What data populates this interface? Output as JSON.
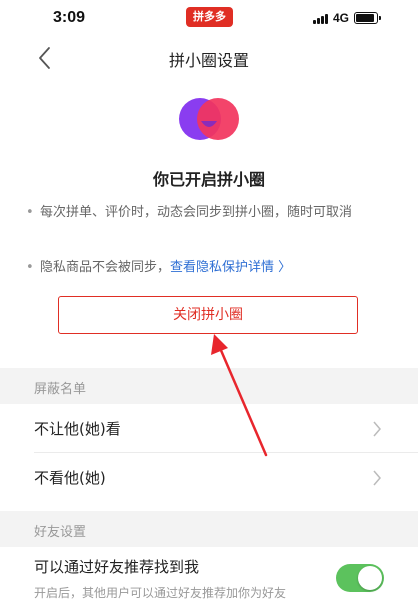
{
  "status_bar": {
    "time": "3:09",
    "app_badge": "拼多多",
    "network": "4G",
    "battery_level": 0.8
  },
  "nav": {
    "title": "拼小圈设置",
    "back_icon": "chevron-left-icon"
  },
  "hero": {
    "icon": "pin-circle-logo-icon",
    "title": "你已开启拼小圈",
    "colors": {
      "purple": "#8a3df0",
      "pink": "#f2345d"
    }
  },
  "bullets": [
    {
      "text": "每次拼单、评价时，动态会同步到拼小圈，随时可取消"
    },
    {
      "text": "隐私商品不会被同步，",
      "link": "查看隐私保护详情 〉"
    }
  ],
  "close_button": {
    "label": "关闭拼小圈"
  },
  "blocklist": {
    "header": "屏蔽名单",
    "items": [
      {
        "label": "不让他(她)看"
      },
      {
        "label": "不看他(她)"
      }
    ]
  },
  "friends": {
    "header": "好友设置",
    "toggle_title": "可以通过好友推荐找到我",
    "toggle_desc": "开启后，其他用户可以通过好友推荐加你为好友",
    "toggle_on": true
  },
  "colors": {
    "accent": "#e02e24",
    "link": "#2f6fd4",
    "toggle_on": "#5cc25d",
    "annotation_arrow": "#e8262d"
  }
}
